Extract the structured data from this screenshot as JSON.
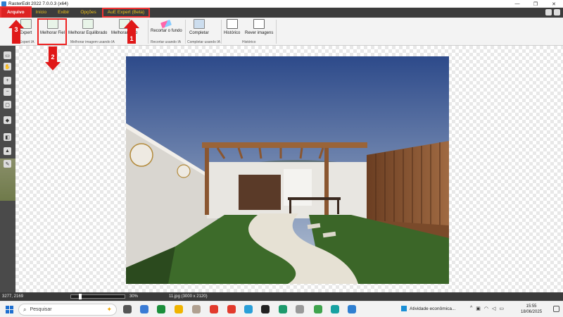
{
  "window": {
    "title": "RasterEdit 2022 7.0.0.3 (x64)",
    "controls": [
      "—",
      "❐",
      "✕"
    ]
  },
  "menu": {
    "items": [
      "Arquivo",
      "Início",
      "Exibir",
      "Opções",
      "AuE Expert (Beta)"
    ]
  },
  "ribbon": {
    "buttons": [
      {
        "label": "Expert",
        "icon": "expert-icon"
      },
      {
        "label": "Melhorar Fiel",
        "icon": "enhance-faithful-icon"
      },
      {
        "label": "Melhorar Equilibrado",
        "icon": "enhance-balanced-icon"
      },
      {
        "label": "Melhorar Amp",
        "icon": "enhance-amp-icon"
      },
      {
        "label": "Recortar o fundo",
        "icon": "eraser-icon"
      },
      {
        "label": "Completar",
        "icon": "complete-icon"
      },
      {
        "label": "Histórico",
        "icon": "history-icon"
      },
      {
        "label": "Rever imagens",
        "icon": "review-images-icon"
      }
    ],
    "groups": [
      "Expert IA",
      "Melhorar imagem usando IA",
      "Recortar usando IA",
      "Completar usando IA",
      "Histórico"
    ]
  },
  "annotations": {
    "arrow1": "1",
    "arrow2": "2",
    "arrow3": "3"
  },
  "status": {
    "coords": "3277, 2169",
    "zoom_percent": 30,
    "zoom": "30%",
    "file": "11.jpg (3000 x 2120)"
  },
  "taskbar": {
    "search_placeholder": "Pesquisar",
    "weather": "Atividade econômica...",
    "time": "15:55",
    "date": "18/06/2025"
  },
  "colors": {
    "menu_accent": "#f0c419",
    "highlight_red": "#e01818",
    "menubar_bg": "#3c3c3c"
  }
}
